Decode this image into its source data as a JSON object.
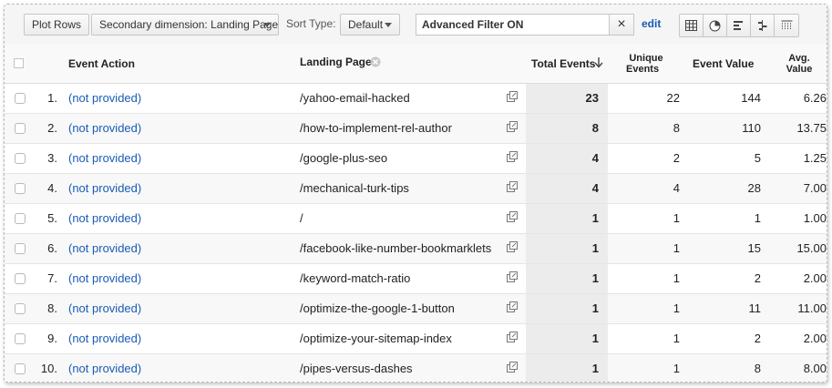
{
  "toolbar": {
    "plot_rows_label": "Plot Rows",
    "secondary_dimension_label": "Secondary dimension: Landing Page",
    "sort_type_label": "Sort Type:",
    "sort_type_value": "Default",
    "filter_value": "Advanced Filter ON",
    "clear_label": "×",
    "edit_label": "edit",
    "views": [
      "table-view-icon",
      "pie-view-icon",
      "performance-view-icon",
      "comparison-view-icon",
      "pivot-view-icon"
    ]
  },
  "table": {
    "headers": {
      "event_action": "Event Action",
      "landing_page": "Landing Page",
      "total_events": "Total Events",
      "unique_events_line1": "Unique",
      "unique_events_line2": "Events",
      "event_value": "Event Value",
      "avg_value_line1": "Avg.",
      "avg_value_line2": "Value"
    },
    "rows": [
      {
        "num": "1.",
        "action": "(not provided)",
        "page": "/yahoo-email-hacked",
        "total": "23",
        "unique": "22",
        "value": "144",
        "avg": "6.26"
      },
      {
        "num": "2.",
        "action": "(not provided)",
        "page": "/how-to-implement-rel-author",
        "total": "8",
        "unique": "8",
        "value": "110",
        "avg": "13.75"
      },
      {
        "num": "3.",
        "action": "(not provided)",
        "page": "/google-plus-seo",
        "total": "4",
        "unique": "2",
        "value": "5",
        "avg": "1.25"
      },
      {
        "num": "4.",
        "action": "(not provided)",
        "page": "/mechanical-turk-tips",
        "total": "4",
        "unique": "4",
        "value": "28",
        "avg": "7.00"
      },
      {
        "num": "5.",
        "action": "(not provided)",
        "page": "/",
        "total": "1",
        "unique": "1",
        "value": "1",
        "avg": "1.00"
      },
      {
        "num": "6.",
        "action": "(not provided)",
        "page": "/facebook-like-number-bookmarklets",
        "total": "1",
        "unique": "1",
        "value": "15",
        "avg": "15.00"
      },
      {
        "num": "7.",
        "action": "(not provided)",
        "page": "/keyword-match-ratio",
        "total": "1",
        "unique": "1",
        "value": "2",
        "avg": "2.00"
      },
      {
        "num": "8.",
        "action": "(not provided)",
        "page": "/optimize-the-google-1-button",
        "total": "1",
        "unique": "1",
        "value": "11",
        "avg": "11.00"
      },
      {
        "num": "9.",
        "action": "(not provided)",
        "page": "/optimize-your-sitemap-index",
        "total": "1",
        "unique": "1",
        "value": "2",
        "avg": "2.00"
      },
      {
        "num": "10.",
        "action": "(not provided)",
        "page": "/pipes-versus-dashes",
        "total": "1",
        "unique": "1",
        "value": "8",
        "avg": "8.00"
      }
    ]
  },
  "colors": {
    "link": "#1a5bb5",
    "sorted_column": "#ececec"
  }
}
